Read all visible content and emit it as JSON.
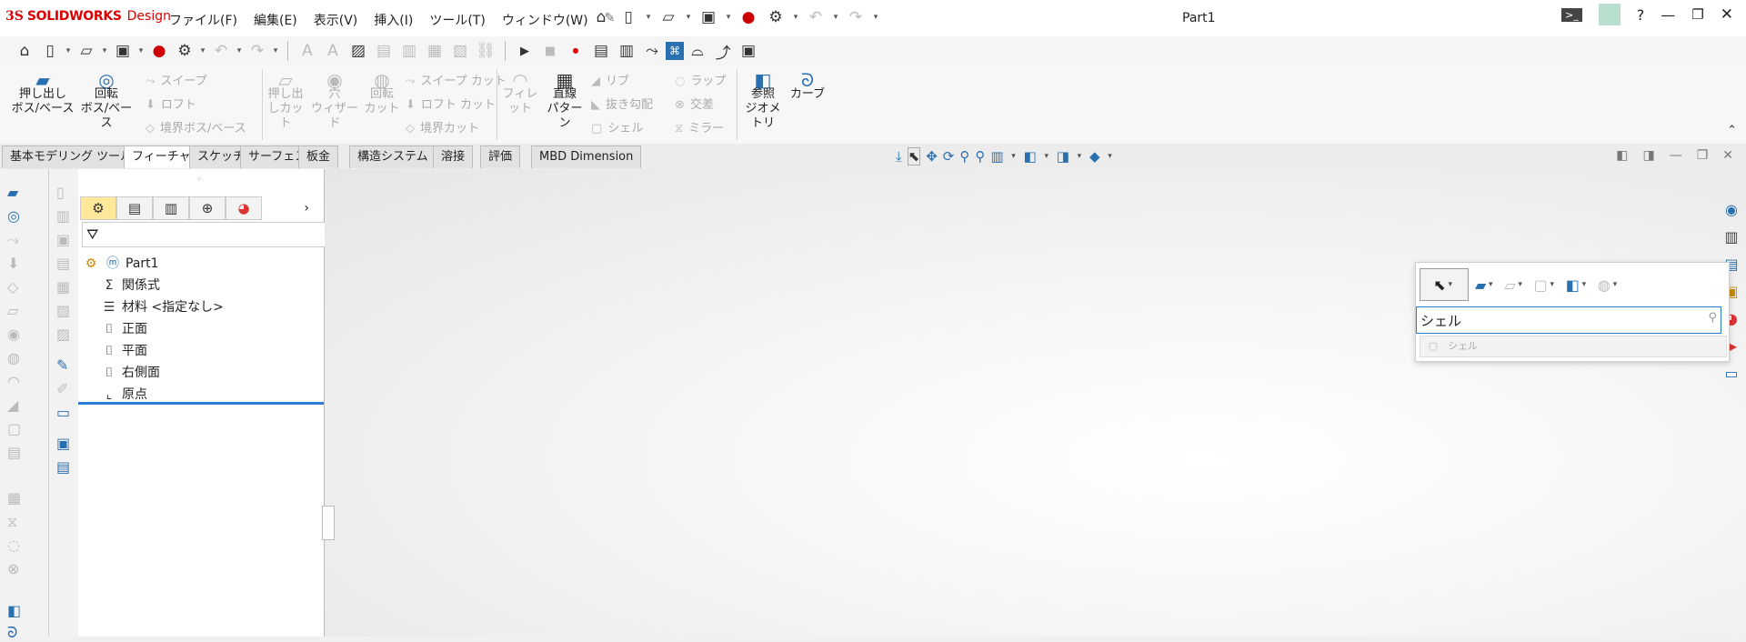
{
  "app": {
    "logo_mark": "3S",
    "logo_name": "SOLIDWORKS",
    "logo_suffix": "Design",
    "document_title": "Part1"
  },
  "menu": {
    "file": "ファイル(F)",
    "edit": "編集(E)",
    "view": "表示(V)",
    "insert": "挿入(I)",
    "tools": "ツール(T)",
    "window": "ウィンドウ(W)"
  },
  "ribbon": {
    "extrude_boss": "押し出し\nボス/ベース",
    "revolve_boss": "回転\nボス/ベース",
    "sweep": "スイープ",
    "loft": "ロフト",
    "boundary_boss": "境界ボス/ベース",
    "extrude_cut": "押し出\nしカット",
    "hole_wizard": "穴\nウィザード",
    "revolve_cut": "回転\nカット",
    "sweep_cut": "スイープ カット",
    "loft_cut": "ロフト カット",
    "boundary_cut": "境界カット",
    "fillet": "フィレット",
    "linear_pattern": "直線\nパターン",
    "rib": "リブ",
    "draft": "抜き勾配",
    "shell": "シェル",
    "wrap": "ラップ",
    "intersect": "交差",
    "mirror": "ミラー",
    "ref_geometry": "参照\nジオメトリ",
    "curves": "カーブ"
  },
  "tabs": [
    "基本モデリング ツール",
    "フィーチャー",
    "スケッチ",
    "サーフェス",
    "板金",
    "構造システム",
    "溶接",
    "評価",
    "MBD Dimension"
  ],
  "tree": {
    "root": "Part1",
    "items": [
      "関係式",
      "材料 <指定なし>",
      "正面",
      "平面",
      "右側面",
      "原点"
    ]
  },
  "shortcut": {
    "search_value": "シェル",
    "result": "シェル"
  },
  "colors": {
    "accent": "#2b7cd3",
    "brand": "#dd0000"
  }
}
